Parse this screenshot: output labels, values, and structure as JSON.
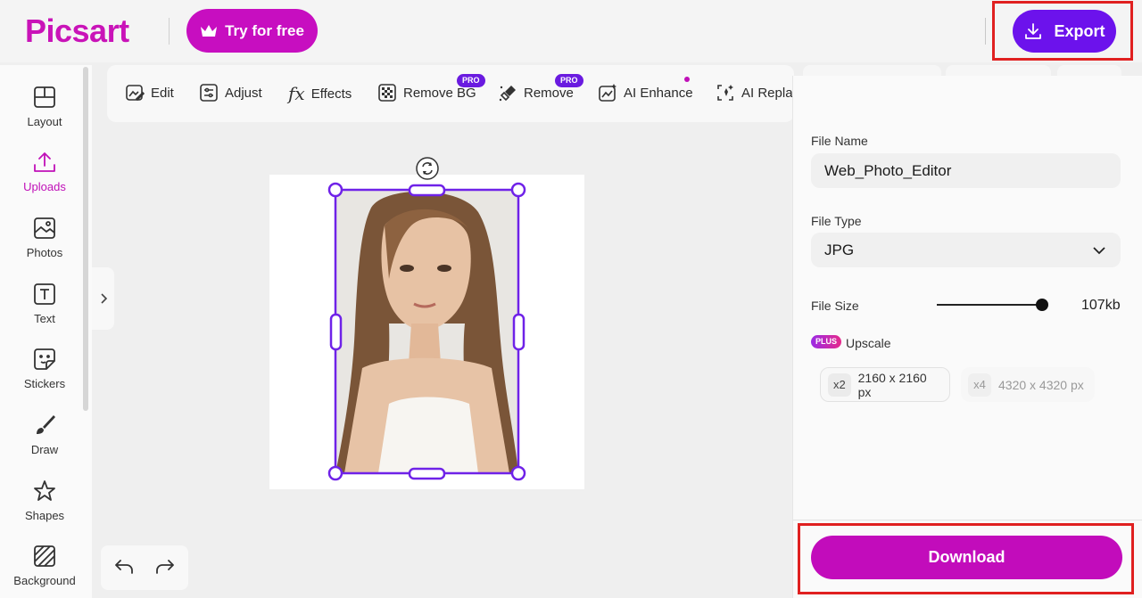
{
  "header": {
    "logo": "Picsart",
    "try_label": "Try for free",
    "export_label": "Export"
  },
  "sidebar": {
    "items": [
      {
        "label": "Layout",
        "icon": "layout-icon"
      },
      {
        "label": "Uploads",
        "icon": "upload-icon"
      },
      {
        "label": "Photos",
        "icon": "photo-icon"
      },
      {
        "label": "Text",
        "icon": "text-icon"
      },
      {
        "label": "Stickers",
        "icon": "sticker-icon"
      },
      {
        "label": "Draw",
        "icon": "brush-icon"
      },
      {
        "label": "Shapes",
        "icon": "star-icon"
      },
      {
        "label": "Background",
        "icon": "background-icon"
      }
    ],
    "active": "Uploads"
  },
  "toolbar": {
    "items": [
      {
        "label": "Edit",
        "icon": "edit-icon"
      },
      {
        "label": "Adjust",
        "icon": "adjust-icon"
      },
      {
        "label": "Effects",
        "icon": "fx-icon"
      },
      {
        "label": "Remove BG",
        "icon": "remove-bg-icon",
        "badge": "PRO"
      },
      {
        "label": "Remove",
        "icon": "eraser-icon",
        "badge": "PRO"
      },
      {
        "label": "AI Enhance",
        "icon": "ai-enhance-icon"
      },
      {
        "label": "AI Repla",
        "icon": "ai-replace-icon"
      }
    ]
  },
  "export_panel": {
    "file_name_label": "File Name",
    "file_name_value": "Web_Photo_Editor",
    "file_type_label": "File Type",
    "file_type_value": "JPG",
    "file_size_label": "File Size",
    "file_size_value": "107kb",
    "file_size_level": 1.0,
    "plus_badge": "PLUS",
    "upscale_label": "Upscale",
    "upscale_options": [
      {
        "mult": "x2",
        "size": "2160 x 2160 px"
      },
      {
        "mult": "x4",
        "size": "4320 x 4320 px"
      }
    ],
    "download_label": "Download"
  },
  "colors": {
    "brand_magenta": "#c70ec0",
    "export_purple": "#6c12ec",
    "highlight_red": "#e02020"
  }
}
